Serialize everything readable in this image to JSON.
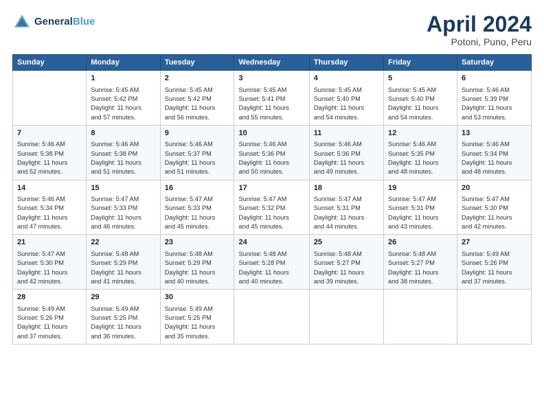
{
  "header": {
    "logo_line1": "General",
    "logo_line2": "Blue",
    "title": "April 2024",
    "location": "Potoni, Puno, Peru"
  },
  "columns": [
    "Sunday",
    "Monday",
    "Tuesday",
    "Wednesday",
    "Thursday",
    "Friday",
    "Saturday"
  ],
  "weeks": [
    [
      {
        "day": "",
        "info": ""
      },
      {
        "day": "1",
        "info": "Sunrise: 5:45 AM\nSunset: 5:42 PM\nDaylight: 11 hours\nand 57 minutes."
      },
      {
        "day": "2",
        "info": "Sunrise: 5:45 AM\nSunset: 5:42 PM\nDaylight: 11 hours\nand 56 minutes."
      },
      {
        "day": "3",
        "info": "Sunrise: 5:45 AM\nSunset: 5:41 PM\nDaylight: 11 hours\nand 55 minutes."
      },
      {
        "day": "4",
        "info": "Sunrise: 5:45 AM\nSunset: 5:40 PM\nDaylight: 11 hours\nand 54 minutes."
      },
      {
        "day": "5",
        "info": "Sunrise: 5:45 AM\nSunset: 5:40 PM\nDaylight: 11 hours\nand 54 minutes."
      },
      {
        "day": "6",
        "info": "Sunrise: 5:46 AM\nSunset: 5:39 PM\nDaylight: 11 hours\nand 53 minutes."
      }
    ],
    [
      {
        "day": "7",
        "info": "Sunrise: 5:46 AM\nSunset: 5:38 PM\nDaylight: 11 hours\nand 52 minutes."
      },
      {
        "day": "8",
        "info": "Sunrise: 5:46 AM\nSunset: 5:38 PM\nDaylight: 11 hours\nand 51 minutes."
      },
      {
        "day": "9",
        "info": "Sunrise: 5:46 AM\nSunset: 5:37 PM\nDaylight: 11 hours\nand 51 minutes."
      },
      {
        "day": "10",
        "info": "Sunrise: 5:46 AM\nSunset: 5:36 PM\nDaylight: 11 hours\nand 50 minutes."
      },
      {
        "day": "11",
        "info": "Sunrise: 5:46 AM\nSunset: 5:36 PM\nDaylight: 11 hours\nand 49 minutes."
      },
      {
        "day": "12",
        "info": "Sunrise: 5:46 AM\nSunset: 5:35 PM\nDaylight: 11 hours\nand 48 minutes."
      },
      {
        "day": "13",
        "info": "Sunrise: 5:46 AM\nSunset: 5:34 PM\nDaylight: 11 hours\nand 48 minutes."
      }
    ],
    [
      {
        "day": "14",
        "info": "Sunrise: 5:46 AM\nSunset: 5:34 PM\nDaylight: 11 hours\nand 47 minutes."
      },
      {
        "day": "15",
        "info": "Sunrise: 5:47 AM\nSunset: 5:33 PM\nDaylight: 11 hours\nand 46 minutes."
      },
      {
        "day": "16",
        "info": "Sunrise: 5:47 AM\nSunset: 5:33 PM\nDaylight: 11 hours\nand 45 minutes."
      },
      {
        "day": "17",
        "info": "Sunrise: 5:47 AM\nSunset: 5:32 PM\nDaylight: 11 hours\nand 45 minutes."
      },
      {
        "day": "18",
        "info": "Sunrise: 5:47 AM\nSunset: 5:31 PM\nDaylight: 11 hours\nand 44 minutes."
      },
      {
        "day": "19",
        "info": "Sunrise: 5:47 AM\nSunset: 5:31 PM\nDaylight: 11 hours\nand 43 minutes."
      },
      {
        "day": "20",
        "info": "Sunrise: 5:47 AM\nSunset: 5:30 PM\nDaylight: 11 hours\nand 42 minutes."
      }
    ],
    [
      {
        "day": "21",
        "info": "Sunrise: 5:47 AM\nSunset: 5:30 PM\nDaylight: 11 hours\nand 42 minutes."
      },
      {
        "day": "22",
        "info": "Sunrise: 5:48 AM\nSunset: 5:29 PM\nDaylight: 11 hours\nand 41 minutes."
      },
      {
        "day": "23",
        "info": "Sunrise: 5:48 AM\nSunset: 5:29 PM\nDaylight: 11 hours\nand 40 minutes."
      },
      {
        "day": "24",
        "info": "Sunrise: 5:48 AM\nSunset: 5:28 PM\nDaylight: 11 hours\nand 40 minutes."
      },
      {
        "day": "25",
        "info": "Sunrise: 5:48 AM\nSunset: 5:27 PM\nDaylight: 11 hours\nand 39 minutes."
      },
      {
        "day": "26",
        "info": "Sunrise: 5:48 AM\nSunset: 5:27 PM\nDaylight: 11 hours\nand 38 minutes."
      },
      {
        "day": "27",
        "info": "Sunrise: 5:49 AM\nSunset: 5:26 PM\nDaylight: 11 hours\nand 37 minutes."
      }
    ],
    [
      {
        "day": "28",
        "info": "Sunrise: 5:49 AM\nSunset: 5:26 PM\nDaylight: 11 hours\nand 37 minutes."
      },
      {
        "day": "29",
        "info": "Sunrise: 5:49 AM\nSunset: 5:25 PM\nDaylight: 11 hours\nand 36 minutes."
      },
      {
        "day": "30",
        "info": "Sunrise: 5:49 AM\nSunset: 5:25 PM\nDaylight: 11 hours\nand 35 minutes."
      },
      {
        "day": "",
        "info": ""
      },
      {
        "day": "",
        "info": ""
      },
      {
        "day": "",
        "info": ""
      },
      {
        "day": "",
        "info": ""
      }
    ]
  ]
}
